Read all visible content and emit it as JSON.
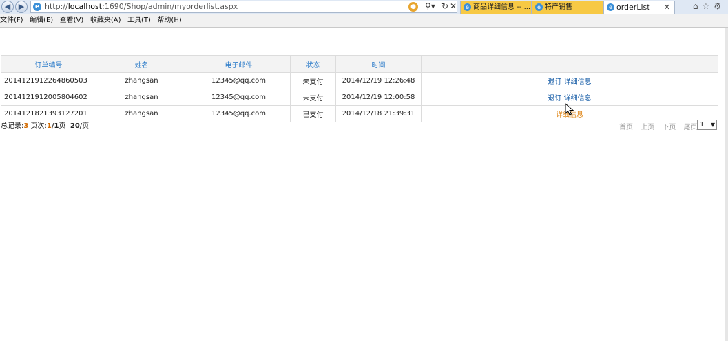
{
  "browser": {
    "url_prefix": "http://",
    "url_host": "localhost",
    "url_rest": ":1690/Shop/admin/myorderlist.aspx",
    "tabs": [
      {
        "label": "商品详细信息 -- ..."
      },
      {
        "label": "特产销售"
      },
      {
        "label": "orderList"
      }
    ]
  },
  "menu": [
    "文件(F)",
    "编辑(E)",
    "查看(V)",
    "收藏夹(A)",
    "工具(T)",
    "帮助(H)"
  ],
  "table": {
    "headers": [
      "订单编号",
      "姓名",
      "电子邮件",
      "状态",
      "时间",
      ""
    ],
    "rows": [
      {
        "order_id": "2014121912264860503",
        "name": "zhangsan",
        "email": "12345@qq.com",
        "status": "未支付",
        "time": "2014/12/19 12:26:48",
        "refund": "退订",
        "detail": "详细信息"
      },
      {
        "order_id": "2014121912005804602",
        "name": "zhangsan",
        "email": "12345@qq.com",
        "status": "未支付",
        "time": "2014/12/19 12:00:58",
        "refund": "退订",
        "detail": "详细信息"
      },
      {
        "order_id": "2014121821393127201",
        "name": "zhangsan",
        "email": "12345@qq.com",
        "status": "已支付",
        "time": "2014/12/18 21:39:31",
        "detail": "详细信息"
      }
    ]
  },
  "pager": {
    "total_label": "总记录:",
    "total": "3",
    "page_label": "页次:",
    "current": "1",
    "sep": "/",
    "pages": "1",
    "page_unit": "页",
    "per_page": "20",
    "per_page_unit": "/页",
    "first": "首页",
    "prev": "上页",
    "next": "下页",
    "last": "尾页",
    "select_value": "1"
  }
}
